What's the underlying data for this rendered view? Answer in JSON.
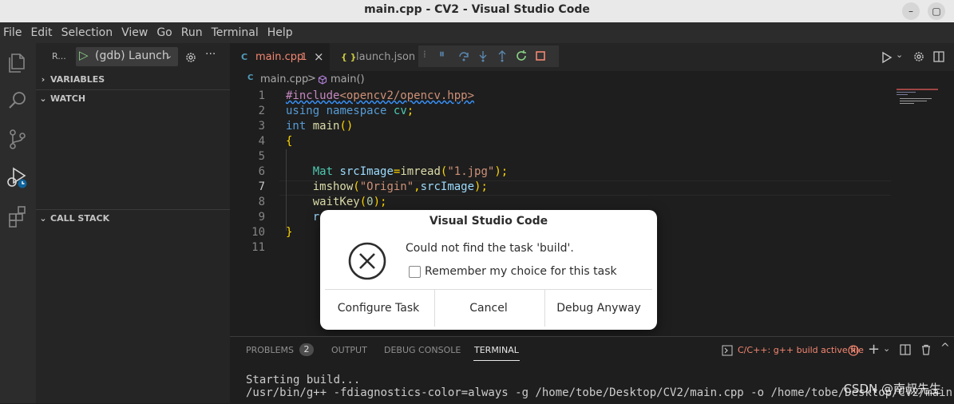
{
  "window": {
    "title": "main.cpp - CV2 - Visual Studio Code",
    "minimize_glyph": "–",
    "maximize_glyph": "▢"
  },
  "menu": [
    "File",
    "Edit",
    "Selection",
    "View",
    "Go",
    "Run",
    "Terminal",
    "Help"
  ],
  "sidebar": {
    "run_label": "R...",
    "launch_config": "(gdb) Launch",
    "sections": {
      "variables": "VARIABLES",
      "watch": "WATCH",
      "call_stack": "CALL STACK"
    }
  },
  "tabs": [
    {
      "label": "main.cpp",
      "badge": "1",
      "icon": "C ",
      "active": true,
      "close": "×"
    },
    {
      "label": "launch.json",
      "icon": "{ }",
      "active": false
    }
  ],
  "breadcrumb": {
    "file": "main.cpp",
    "symbol": "main()",
    "sep": ">"
  },
  "code_lines": [
    {
      "n": "1",
      "html_text": "#include<opencv2/opencv.hpp>"
    },
    {
      "n": "2",
      "html_text": "using namespace cv;"
    },
    {
      "n": "3",
      "html_text": "int main()"
    },
    {
      "n": "4",
      "html_text": "{"
    },
    {
      "n": "5",
      "html_text": ""
    },
    {
      "n": "6",
      "html_text": "    Mat srcImage=imread(\"1.jpg\");"
    },
    {
      "n": "7",
      "html_text": "    imshow(\"Origin\",srcImage);"
    },
    {
      "n": "8",
      "html_text": "    waitKey(0);"
    },
    {
      "n": "9",
      "html_text": "    r"
    },
    {
      "n": "10",
      "html_text": "}"
    },
    {
      "n": "11",
      "html_text": ""
    }
  ],
  "dialog": {
    "title": "Visual Studio Code",
    "message": "Could not find the task 'build'.",
    "checkbox_label": "Remember my choice for this task",
    "checkbox_checked": false,
    "buttons": [
      "Configure Task",
      "Cancel",
      "Debug Anyway"
    ]
  },
  "panel": {
    "tabs": [
      "PROBLEMS",
      "OUTPUT",
      "DEBUG CONSOLE",
      "TERMINAL"
    ],
    "problems_count": "2",
    "active_tab": "TERMINAL",
    "task_label": "C/C++: g++ build active file",
    "terminal_lines": [
      "Starting build...",
      "/usr/bin/g++ -fdiagnostics-color=always -g /home/tobe/Desktop/CV2/main.cpp -o /home/tobe/Desktop/CV2/main"
    ]
  },
  "watermark": "CSDN @南叔先生",
  "colors": {
    "accent": "#0e639c",
    "error": "#f14c4c",
    "keyword": "#569cd6",
    "string": "#ce9178",
    "function": "#dcdcaa",
    "type": "#4ec9b0",
    "number": "#b5cea8",
    "preprocessor": "#c586c0"
  }
}
